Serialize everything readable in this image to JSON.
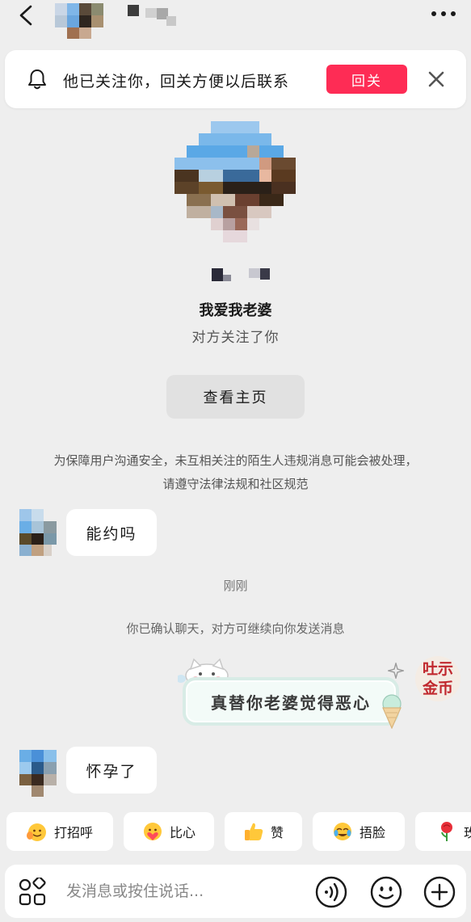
{
  "banner": {
    "text": "他已关注你，回关方便以后联系",
    "follow_back": "回关"
  },
  "profile": {
    "name": "我爱我老婆",
    "status": "对方关注了你",
    "view_home": "查看主页"
  },
  "safety_notice": "为保障用户沟通安全，未互相关注的陌生人违规消息可能会被处理，请遵守法律法规和社区规范",
  "messages": [
    {
      "text": "能约吗"
    },
    {
      "text": "怀孕了"
    }
  ],
  "chat_time": "刚刚",
  "chat_system": "你已确认聊天，对方可继续向你发送消息",
  "sticker_text": "真替你老婆觉得恶心",
  "self_avatar_text": [
    "吐",
    "示",
    "金",
    "币"
  ],
  "quick_replies": [
    {
      "label": "打招呼",
      "icon": "wave-emoji-icon"
    },
    {
      "label": "比心",
      "icon": "heart-hands-emoji-icon"
    },
    {
      "label": "赞",
      "icon": "thumbs-up-emoji-icon"
    },
    {
      "label": "捂脸",
      "icon": "facepalm-emoji-icon"
    },
    {
      "label": "玫",
      "icon": "rose-emoji-icon"
    }
  ],
  "input": {
    "placeholder": "发消息或按住说话..."
  },
  "colors": {
    "accent": "#fe2c55",
    "background": "#eeeeee"
  }
}
